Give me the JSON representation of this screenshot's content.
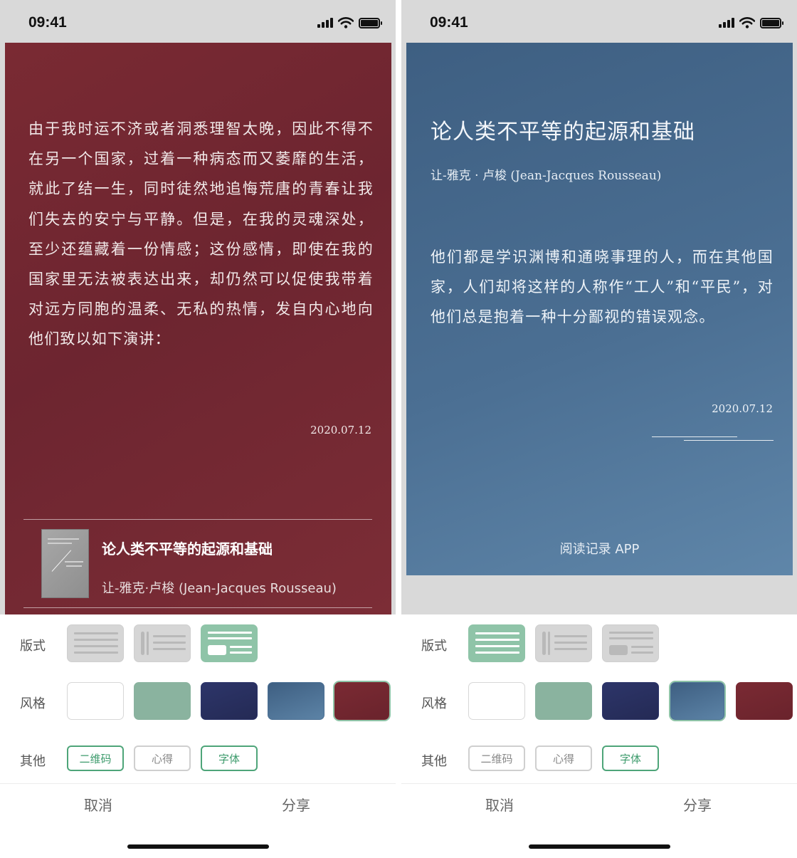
{
  "status_bar": {
    "time": "09:41"
  },
  "left": {
    "quote": "由于我时运不济或者洞悉理智太晚，因此不得不在另一个国家，过着一种病态而又萎靡的生活，就此了结一生，同时徒然地追悔荒唐的青春让我们失去的安宁与平静。但是，在我的灵魂深处，至少还蕴藏着一份情感；这份感情，即使在我的国家里无法被表达出来，却仍然可以促使我带着对远方同胞的温柔、无私的热情，发自内心地向他们致以如下演讲：",
    "date": "2020.07.12",
    "book": {
      "title": "论人类不平等的起源和基础",
      "author": "让-雅克·卢梭 (Jean-Jacques Rousseau)"
    },
    "selected_layout": 3,
    "selected_style": "dark-red",
    "options_on": [
      "二维码",
      "字体"
    ]
  },
  "right": {
    "title": "论人类不平等的起源和基础",
    "author": "让-雅克 · 卢梭 (Jean-Jacques Rousseau)",
    "quote": "他们都是学识渊博和通晓事理的人，而在其他国家，人们却将这样的人称作“工人”和“平民”，对他们总是抱着一种十分鄙视的错误观念。",
    "date": "2020.07.12",
    "brand": "阅读记录 APP",
    "selected_layout": 1,
    "selected_style": "steel-blue",
    "options_on": [
      "字体"
    ]
  },
  "settings": {
    "layout_label": "版式",
    "style_label": "风格",
    "other_label": "其他",
    "styles": [
      {
        "name": "white",
        "color": "#ffffff"
      },
      {
        "name": "sage-green",
        "color": "#8ab39f"
      },
      {
        "name": "navy",
        "color": "#2d3569"
      },
      {
        "name": "steel-blue",
        "color": "#4b6f93"
      },
      {
        "name": "dark-red",
        "color": "#7a2a33"
      }
    ],
    "chips": [
      "二维码",
      "心得",
      "字体"
    ],
    "cancel": "取消",
    "share": "分享"
  },
  "colors": {
    "accent": "#8fc4a8",
    "accent_text": "#3d9b6c"
  }
}
